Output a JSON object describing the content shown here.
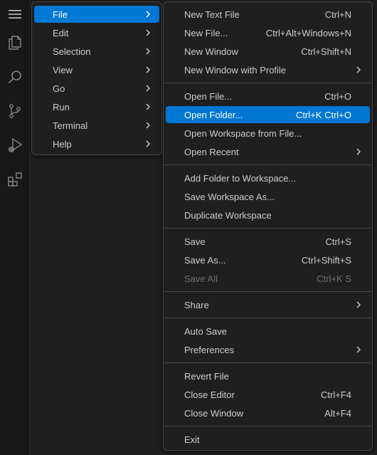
{
  "colors": {
    "accent": "#0078d4",
    "menu_bg": "#1f1f1f",
    "border": "#454545",
    "text": "#cccccc",
    "disabled": "#6e6e6e"
  },
  "activity_bar": {
    "icons": [
      "menu-icon",
      "explorer-icon",
      "search-icon",
      "source-control-icon",
      "run-debug-icon",
      "extensions-icon"
    ]
  },
  "menubar": {
    "items": [
      {
        "label": "File",
        "active": true
      },
      {
        "label": "Edit"
      },
      {
        "label": "Selection"
      },
      {
        "label": "View"
      },
      {
        "label": "Go"
      },
      {
        "label": "Run"
      },
      {
        "label": "Terminal"
      },
      {
        "label": "Help"
      }
    ]
  },
  "file_menu": {
    "groups": [
      [
        {
          "label": "New Text File",
          "shortcut": "Ctrl+N"
        },
        {
          "label": "New File...",
          "shortcut": "Ctrl+Alt+Windows+N"
        },
        {
          "label": "New Window",
          "shortcut": "Ctrl+Shift+N"
        },
        {
          "label": "New Window with Profile",
          "submenu": true
        }
      ],
      [
        {
          "label": "Open File...",
          "shortcut": "Ctrl+O"
        },
        {
          "label": "Open Folder...",
          "shortcut": "Ctrl+K Ctrl+O",
          "active": true
        },
        {
          "label": "Open Workspace from File..."
        },
        {
          "label": "Open Recent",
          "submenu": true
        }
      ],
      [
        {
          "label": "Add Folder to Workspace..."
        },
        {
          "label": "Save Workspace As..."
        },
        {
          "label": "Duplicate Workspace"
        }
      ],
      [
        {
          "label": "Save",
          "shortcut": "Ctrl+S"
        },
        {
          "label": "Save As...",
          "shortcut": "Ctrl+Shift+S"
        },
        {
          "label": "Save All",
          "shortcut": "Ctrl+K S",
          "disabled": true
        }
      ],
      [
        {
          "label": "Share",
          "submenu": true
        }
      ],
      [
        {
          "label": "Auto Save"
        },
        {
          "label": "Preferences",
          "submenu": true
        }
      ],
      [
        {
          "label": "Revert File"
        },
        {
          "label": "Close Editor",
          "shortcut": "Ctrl+F4"
        },
        {
          "label": "Close Window",
          "shortcut": "Alt+F4"
        }
      ],
      [
        {
          "label": "Exit"
        }
      ]
    ]
  }
}
